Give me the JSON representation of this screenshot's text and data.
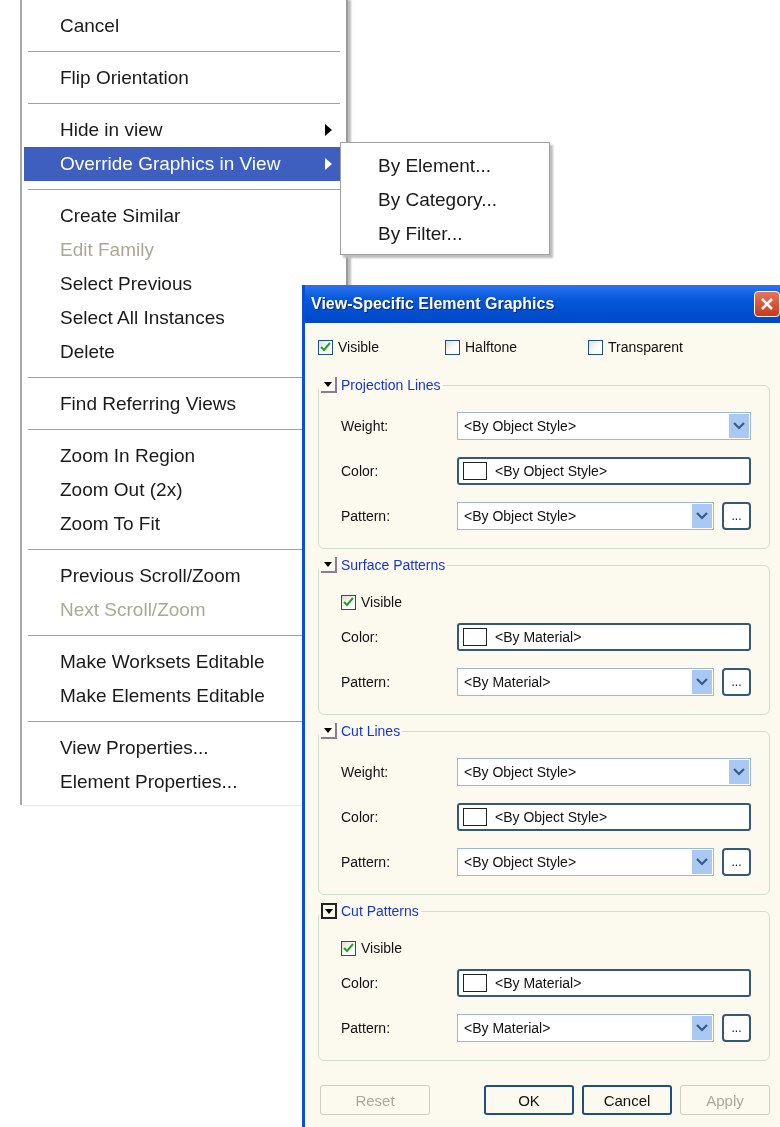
{
  "context_menu": {
    "groups": [
      [
        {
          "label": "Cancel",
          "disabled": false,
          "selected": false,
          "submenu": false
        }
      ],
      [
        {
          "label": "Flip Orientation",
          "disabled": false,
          "selected": false,
          "submenu": false
        }
      ],
      [
        {
          "label": "Hide in view",
          "disabled": false,
          "selected": false,
          "submenu": true
        },
        {
          "label": "Override Graphics in View",
          "disabled": false,
          "selected": true,
          "submenu": true
        }
      ],
      [
        {
          "label": "Create Similar",
          "disabled": false,
          "selected": false,
          "submenu": false
        },
        {
          "label": "Edit Family",
          "disabled": true,
          "selected": false,
          "submenu": false
        },
        {
          "label": "Select Previous",
          "disabled": false,
          "selected": false
        },
        {
          "label": "Select All Instances",
          "disabled": false,
          "selected": false
        },
        {
          "label": "Delete",
          "disabled": false,
          "selected": false
        }
      ],
      [
        {
          "label": "Find Referring Views",
          "disabled": false,
          "selected": false
        }
      ],
      [
        {
          "label": "Zoom In Region",
          "disabled": false,
          "selected": false
        },
        {
          "label": "Zoom Out (2x)",
          "disabled": false,
          "selected": false
        },
        {
          "label": "Zoom To Fit",
          "disabled": false,
          "selected": false
        }
      ],
      [
        {
          "label": "Previous Scroll/Zoom",
          "disabled": false,
          "selected": false
        },
        {
          "label": "Next Scroll/Zoom",
          "disabled": true,
          "selected": false
        }
      ],
      [
        {
          "label": "Make Worksets Editable",
          "disabled": false,
          "selected": false
        },
        {
          "label": "Make Elements Editable",
          "disabled": false,
          "selected": false
        }
      ],
      [
        {
          "label": "View Properties...",
          "disabled": false,
          "selected": false
        },
        {
          "label": "Element Properties...",
          "disabled": false,
          "selected": false
        }
      ]
    ]
  },
  "submenu": {
    "items": [
      "By Element...",
      "By Category...",
      "By Filter..."
    ]
  },
  "dialog": {
    "title": "View-Specific Element Graphics",
    "options": [
      {
        "label": "Visible",
        "checked": true
      },
      {
        "label": "Halftone",
        "checked": false
      },
      {
        "label": "Transparent",
        "checked": false
      }
    ],
    "sections": [
      {
        "title": "Projection Lines",
        "expanded": true,
        "focused": false,
        "rows": [
          {
            "kind": "dropdown",
            "label": "Weight:",
            "value": "<By Object Style>"
          },
          {
            "kind": "color",
            "label": "Color:",
            "value": "<By Object Style>"
          },
          {
            "kind": "pattern",
            "label": "Pattern:",
            "value": "<By Object Style>",
            "browse": "..."
          }
        ]
      },
      {
        "title": "Surface Patterns",
        "expanded": true,
        "focused": false,
        "rows": [
          {
            "kind": "checkbox",
            "label": "Visible",
            "checked": true
          },
          {
            "kind": "color",
            "label": "Color:",
            "value": "<By Material>"
          },
          {
            "kind": "pattern",
            "label": "Pattern:",
            "value": "<By Material>",
            "browse": "..."
          }
        ]
      },
      {
        "title": "Cut Lines",
        "expanded": true,
        "focused": false,
        "rows": [
          {
            "kind": "dropdown",
            "label": "Weight:",
            "value": "<By Object Style>"
          },
          {
            "kind": "color",
            "label": "Color:",
            "value": "<By Object Style>"
          },
          {
            "kind": "pattern",
            "label": "Pattern:",
            "value": "<By Object Style>",
            "browse": "..."
          }
        ]
      },
      {
        "title": "Cut Patterns",
        "expanded": true,
        "focused": true,
        "rows": [
          {
            "kind": "checkbox",
            "label": "Visible",
            "checked": true
          },
          {
            "kind": "color",
            "label": "Color:",
            "value": "<By Material>"
          },
          {
            "kind": "pattern",
            "label": "Pattern:",
            "value": "<By Material>",
            "browse": "..."
          }
        ]
      }
    ],
    "buttons": [
      {
        "label": "Reset",
        "disabled": true
      },
      {
        "label": "OK",
        "disabled": false
      },
      {
        "label": "Cancel",
        "disabled": false
      },
      {
        "label": "Apply",
        "disabled": true
      }
    ]
  }
}
